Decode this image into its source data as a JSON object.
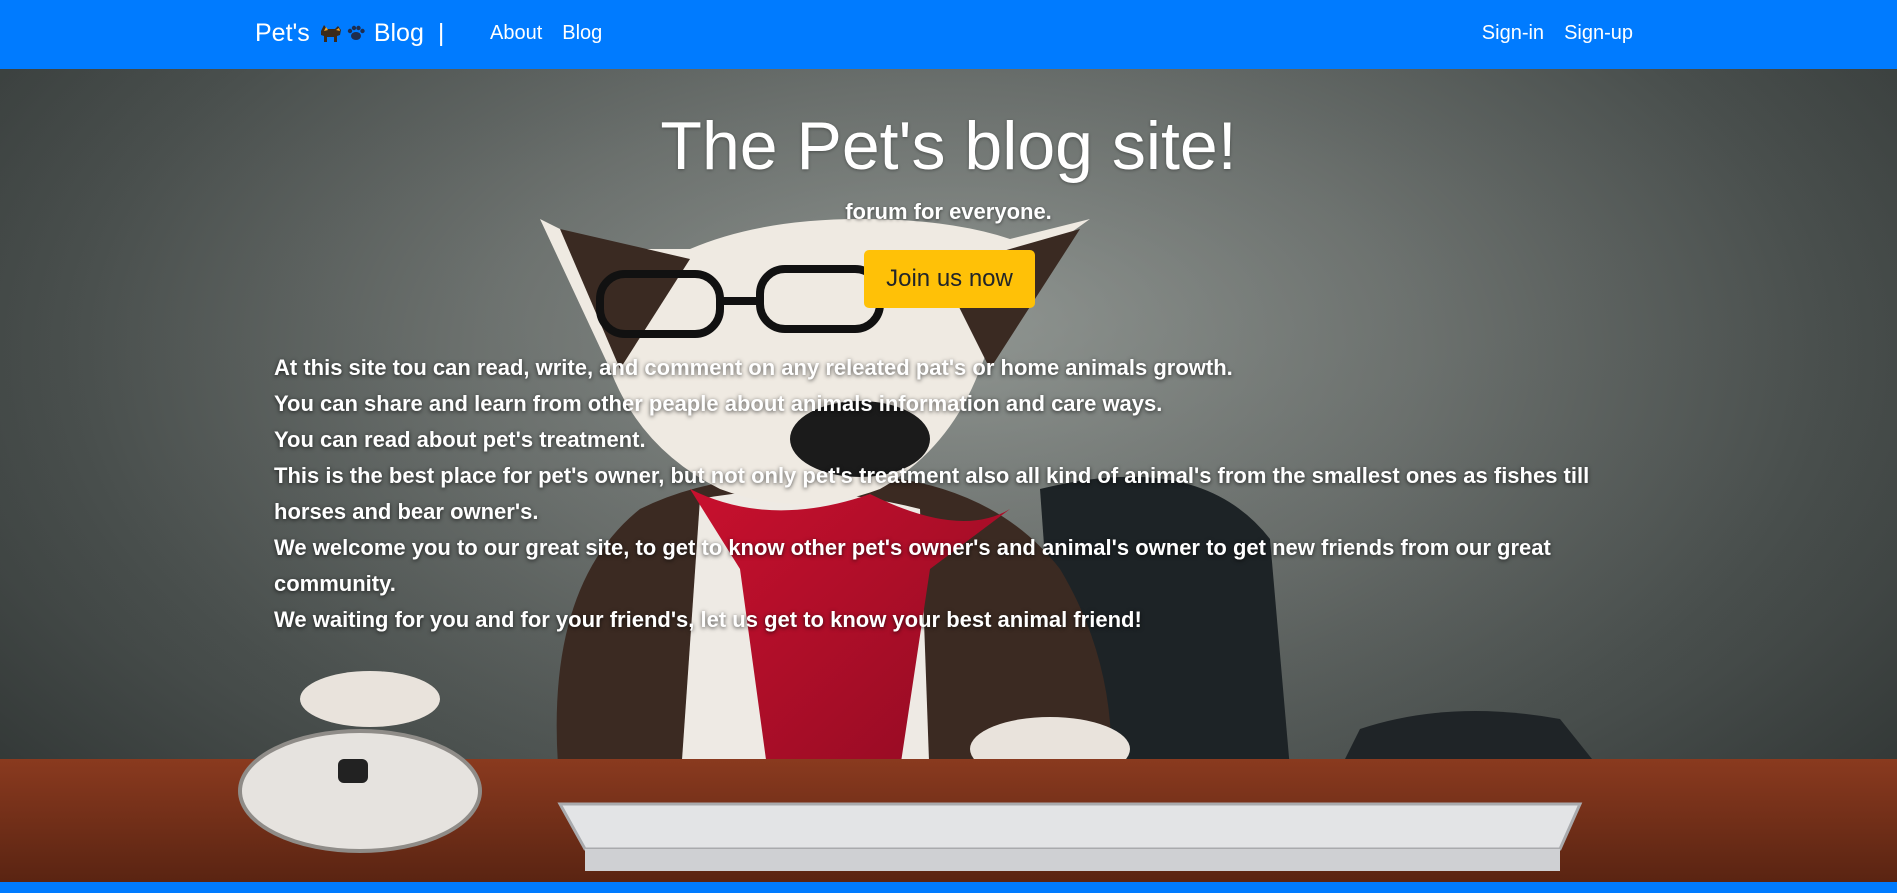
{
  "navbar": {
    "brand_left": "Pet's",
    "brand_right": "Blog",
    "brand_separator": "|",
    "brand_icons": [
      "dog-icon",
      "paw-icon"
    ],
    "links_left": [
      {
        "label": "About"
      },
      {
        "label": "Blog"
      }
    ],
    "links_right": [
      {
        "label": "Sign-in"
      },
      {
        "label": "Sign-up"
      }
    ]
  },
  "hero": {
    "title": "The Pet's blog site!",
    "subtitle": "forum for everyone.",
    "cta_label": "Join us now",
    "paragraphs": [
      "At this site tou can read, write, and comment on any releated pat's or home animals growth.",
      "You can share and learn from other peaple about animals information and care ways.",
      "You can read about pet's treatment.",
      "This is the best place for pet's owner, but not only pet's treatment also all kind of animal's from the smallest ones as fishes till horses and bear owner's.",
      "We welcome you to our great site, to get to know other pet's owner's and animal's owner to get new friends from our great community.",
      "We waiting for you and for your friend's, let us get to know your best animal friend!"
    ]
  },
  "colors": {
    "primary": "#007bff",
    "warning": "#ffc107"
  }
}
